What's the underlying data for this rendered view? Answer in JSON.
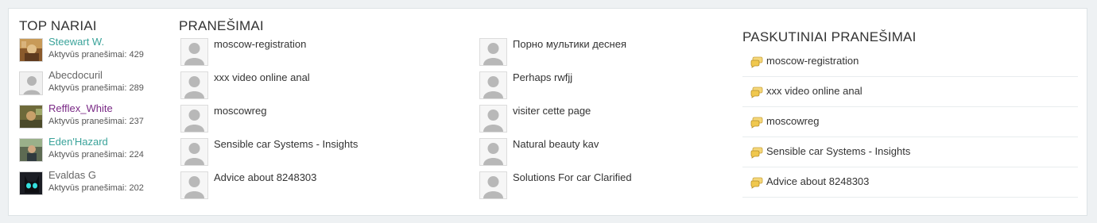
{
  "top_members": {
    "heading": "TOP NARIAI",
    "members": [
      {
        "name": "Steewart W.",
        "count_label": "Aktyvūs pranešimai:",
        "count": "429",
        "name_color": "#3aa39a",
        "avatar": "photo-avatar"
      },
      {
        "name": "Abecdocuril",
        "count_label": "Aktyvūs pranešimai:",
        "count": "289",
        "name_color": "#666666",
        "avatar": "default-avatar"
      },
      {
        "name": "Refflex_White",
        "count_label": "Aktyvūs pranešimai:",
        "count": "237",
        "name_color": "#7a2a86",
        "avatar": "photo-avatar"
      },
      {
        "name": "Eden'Hazard",
        "count_label": "Aktyvūs pranešimai:",
        "count": "224",
        "name_color": "#3aa39a",
        "avatar": "photo-avatar"
      },
      {
        "name": "Evaldas G",
        "count_label": "Aktyvūs pranešimai:",
        "count": "202",
        "name_color": "#666666",
        "avatar": "dark-creature-avatar"
      }
    ]
  },
  "posts": {
    "heading": "PRANEŠIMAI",
    "left": [
      {
        "title": "moscow-registration"
      },
      {
        "title": "xxx video online anal"
      },
      {
        "title": "moscowreg"
      },
      {
        "title": "Sensible car Systems - Insights"
      },
      {
        "title": "Advice about 8248303"
      }
    ],
    "right": [
      {
        "title": "Порно мультики деснея"
      },
      {
        "title": "Perhaps rwfjj"
      },
      {
        "title": "visiter cette page"
      },
      {
        "title": "Natural beauty kav"
      },
      {
        "title": "Solutions For car Clarified"
      }
    ]
  },
  "latest": {
    "heading": "PASKUTINIAI PRANEŠIMAI",
    "icon": "speech-bubble-icon",
    "items": [
      {
        "title": "moscow-registration"
      },
      {
        "title": "xxx video online anal"
      },
      {
        "title": "moscowreg"
      },
      {
        "title": "Sensible car Systems - Insights"
      },
      {
        "title": "Advice about 8248303"
      }
    ]
  }
}
